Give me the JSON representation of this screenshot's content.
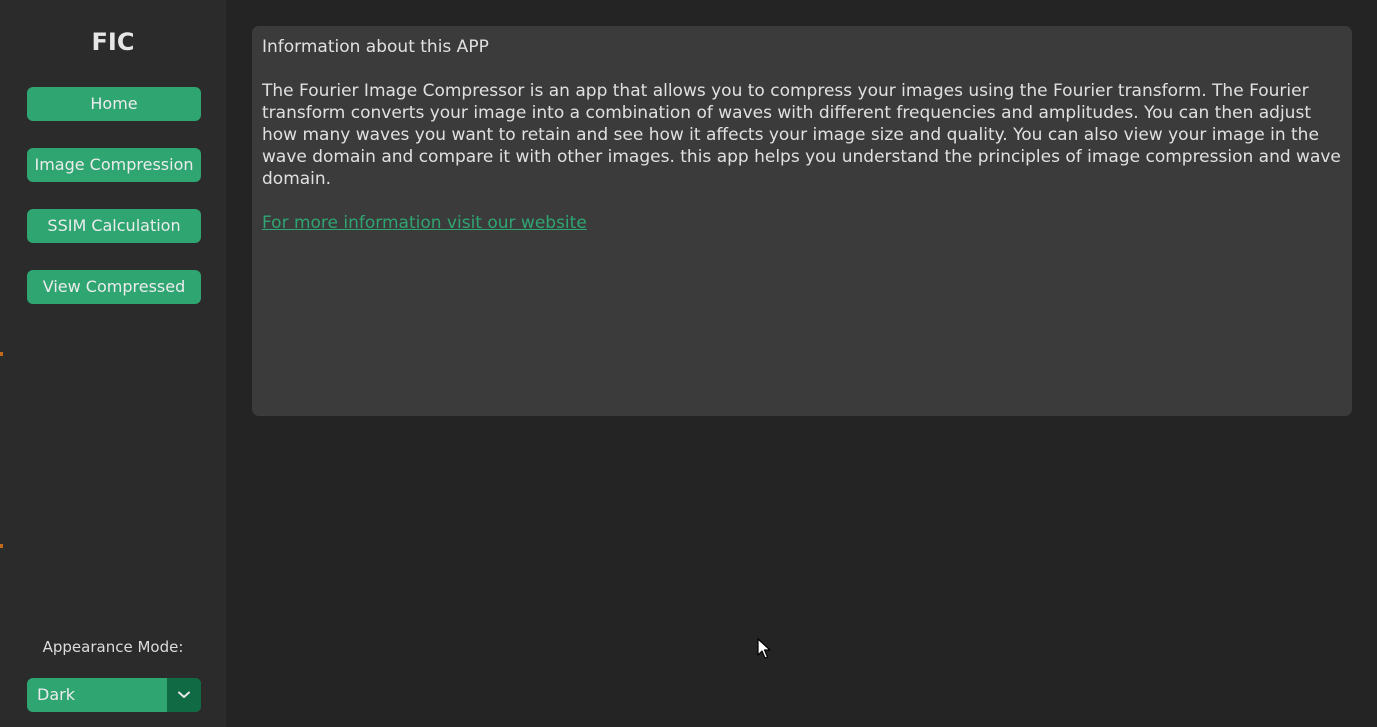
{
  "app": {
    "title": "FIC"
  },
  "sidebar": {
    "nav": [
      {
        "label": "Home"
      },
      {
        "label": "Image Compression"
      },
      {
        "label": "SSIM Calculation"
      },
      {
        "label": "View Compressed"
      }
    ],
    "appearance_label": "Appearance Mode:",
    "appearance_select": {
      "value": "Dark",
      "icon": "chevron-down-icon"
    }
  },
  "main": {
    "info_title": "Information about this APP",
    "info_body": "The Fourier Image Compressor is an app that allows you to compress your images using the Fourier transform. The Fourier transform converts your image into a combination of waves with different frequencies and amplitudes. You can then adjust how many waves you want to retain and see how it affects your image size and quality. You can also view your image in the wave domain and compare it with other images. this app helps you understand the principles of image compression and wave domain.",
    "info_link": "For more information visit our website"
  },
  "colors": {
    "accent": "#2fa572",
    "accent_dark": "#106a43",
    "background": "#242424",
    "sidebar": "#2b2b2b",
    "panel": "#3b3b3b"
  }
}
